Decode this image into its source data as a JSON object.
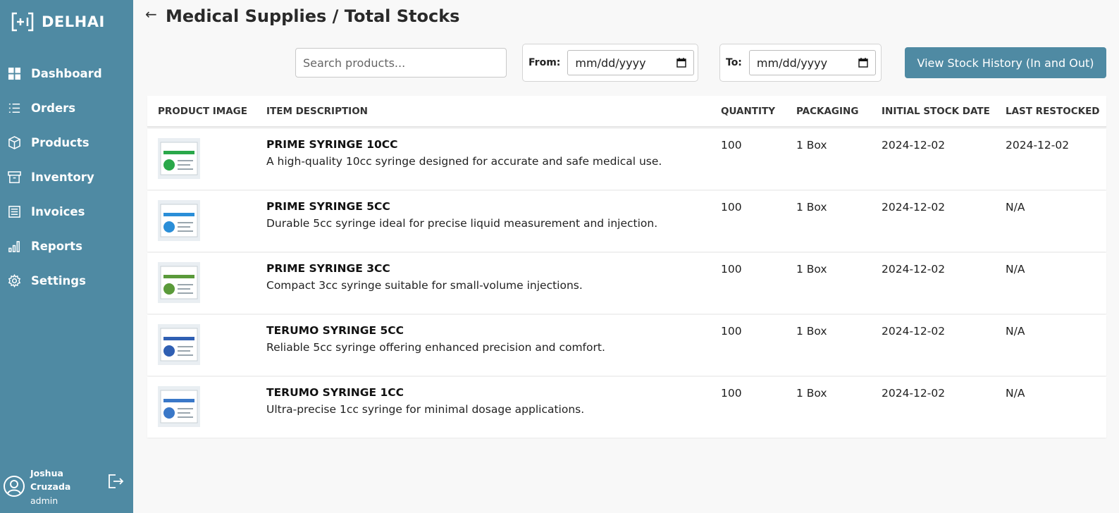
{
  "brand": {
    "name": "DELHAI"
  },
  "nav": [
    {
      "label": "Dashboard",
      "icon": "dashboard-icon"
    },
    {
      "label": "Orders",
      "icon": "list-icon"
    },
    {
      "label": "Products",
      "icon": "box-icon"
    },
    {
      "label": "Inventory",
      "icon": "archive-icon"
    },
    {
      "label": "Invoices",
      "icon": "invoice-icon"
    },
    {
      "label": "Reports",
      "icon": "bar-chart-icon"
    },
    {
      "label": "Settings",
      "icon": "gear-icon"
    }
  ],
  "user": {
    "name": "Joshua Cruzada",
    "role": "admin"
  },
  "header": {
    "back": "←",
    "title": "Medical Supplies / Total Stocks"
  },
  "filters": {
    "search_placeholder": "Search products...",
    "from_label": "From:",
    "to_label": "To:",
    "date_placeholder": "mm/dd/yyyy",
    "history_button": "View Stock History (In and Out)"
  },
  "table": {
    "columns": [
      "PRODUCT IMAGE",
      "ITEM DESCRIPTION",
      "QUANTITY",
      "PACKAGING",
      "INITIAL STOCK DATE",
      "LAST RESTOCKED"
    ],
    "rows": [
      {
        "name": "PRIME SYRINGE 10CC",
        "description": "A high-quality 10cc syringe designed for accurate and safe medical use.",
        "quantity": "100",
        "packaging": "1 Box",
        "initial": "2024-12-02",
        "last": "2024-12-02",
        "accent": "#2aa84a"
      },
      {
        "name": "PRIME SYRINGE 5CC",
        "description": "Durable 5cc syringe ideal for precise liquid measurement and injection.",
        "quantity": "100",
        "packaging": "1 Box",
        "initial": "2024-12-02",
        "last": "N/A",
        "accent": "#2a8ed8"
      },
      {
        "name": "PRIME SYRINGE 3CC",
        "description": "Compact 3cc syringe suitable for small-volume injections.",
        "quantity": "100",
        "packaging": "1 Box",
        "initial": "2024-12-02",
        "last": "N/A",
        "accent": "#5a9a3a"
      },
      {
        "name": "TERUMO SYRINGE 5CC",
        "description": "Reliable 5cc syringe offering enhanced precision and comfort.",
        "quantity": "100",
        "packaging": "1 Box",
        "initial": "2024-12-02",
        "last": "N/A",
        "accent": "#2f5fb3"
      },
      {
        "name": "TERUMO SYRINGE 1CC",
        "description": "Ultra-precise 1cc syringe for minimal dosage applications.",
        "quantity": "100",
        "packaging": "1 Box",
        "initial": "2024-12-02",
        "last": "N/A",
        "accent": "#3a78c8"
      }
    ]
  },
  "colors": {
    "sidebar": "#4f8aa3",
    "button": "#4f8aa3",
    "background": "#f8f8f8"
  }
}
